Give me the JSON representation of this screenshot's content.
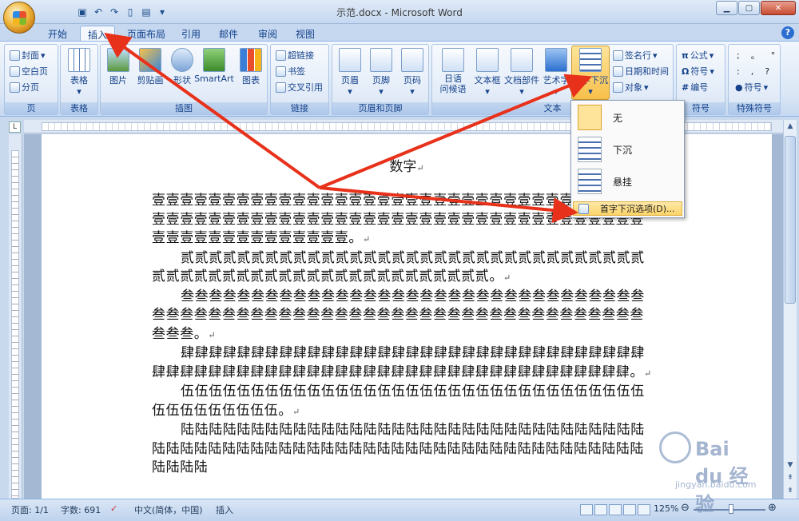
{
  "window": {
    "title": "示范.docx - Microsoft Word"
  },
  "tabs": [
    "开始",
    "插入",
    "页面布局",
    "引用",
    "邮件",
    "审阅",
    "视图"
  ],
  "ribbon": {
    "groups": {
      "pages": {
        "label": "页",
        "items": [
          "封面",
          "空白页",
          "分页"
        ]
      },
      "tables": {
        "label": "表格",
        "items": [
          "表格"
        ]
      },
      "illustrations": {
        "label": "插图",
        "items": [
          "图片",
          "剪贴画",
          "形状",
          "SmartArt",
          "图表"
        ]
      },
      "links": {
        "label": "链接",
        "items": [
          "超链接",
          "书签",
          "交叉引用"
        ]
      },
      "header_footer": {
        "label": "页眉和页脚",
        "items": [
          "页眉",
          "页脚",
          "页码"
        ]
      },
      "text": {
        "label": "文本",
        "items": [
          "日语\n问候语",
          "文本框",
          "文档部件",
          "艺术字",
          "首字下沉"
        ]
      },
      "text_small": [
        "签名行",
        "日期和时间",
        "对象"
      ],
      "symbols": {
        "label": "符号",
        "items": [
          "公式",
          "符号",
          "编号"
        ]
      },
      "special": {
        "label": "特殊符号",
        "items": [
          "符号"
        ],
        "glyphs": [
          ";",
          "。",
          ",",
          "?"
        ]
      }
    }
  },
  "dropcap_menu": {
    "items": [
      "无",
      "下沉",
      "悬挂"
    ],
    "options": "首字下沉选项(D)..."
  },
  "document": {
    "heading": "数字",
    "paragraphs": [
      "壹壹壹壹壹壹壹壹壹壹壹壹壹壹壹壹壹壹壹壹壹壹壹壹壹壹壹壹壹壹壹壹壹壹壹壹壹壹壹壹壹壹壹壹壹壹壹壹壹壹壹壹壹壹壹壹壹壹壹壹壹壹壹壹壹壹壹壹壹壹壹壹壹壹壹壹壹壹壹壹壹壹壹壹。",
      "贰贰贰贰贰贰贰贰贰贰贰贰贰贰贰贰贰贰贰贰贰贰贰贰贰贰贰贰贰贰贰贰贰贰贰贰贰贰贰贰贰贰贰贰贰贰贰贰贰贰贰贰贰贰贰贰贰。",
      "叁叁叁叁叁叁叁叁叁叁叁叁叁叁叁叁叁叁叁叁叁叁叁叁叁叁叁叁叁叁叁叁叁叁叁叁叁叁叁叁叁叁叁叁叁叁叁叁叁叁叁叁叁叁叁叁叁叁叁叁叁叁叁叁叁叁叁叁叁叁叁。",
      "肆肆肆肆肆肆肆肆肆肆肆肆肆肆肆肆肆肆肆肆肆肆肆肆肆肆肆肆肆肆肆肆肆肆肆肆肆肆肆肆肆肆肆肆肆肆肆肆肆肆肆肆肆肆肆肆肆肆肆肆肆肆肆肆肆肆肆。",
      "伍伍伍伍伍伍伍伍伍伍伍伍伍伍伍伍伍伍伍伍伍伍伍伍伍伍伍伍伍伍伍伍伍伍伍伍伍伍伍伍伍伍。",
      "陆陆陆陆陆陆陆陆陆陆陆陆陆陆陆陆陆陆陆陆陆陆陆陆陆陆陆陆陆陆陆陆陆陆陆陆陆陆陆陆陆陆陆陆陆陆陆陆陆陆陆陆陆陆陆陆陆陆陆陆陆陆陆陆陆陆陆陆陆陆陆陆"
    ],
    "paragraph_mark": "↵"
  },
  "statusbar": {
    "page": "页面: 1/1",
    "words": "字数: 691",
    "language": "中文(简体，中国)",
    "mode": "插入",
    "zoom": "125%",
    "zoom_out": "⊖",
    "zoom_in": "⊕"
  },
  "watermark": {
    "brand": "Bai du 经验",
    "url": "jingyan.baidu.com"
  },
  "colors": {
    "accent": "#15428b",
    "arrow": "#e8311a",
    "highlight": "#fbd46a"
  }
}
